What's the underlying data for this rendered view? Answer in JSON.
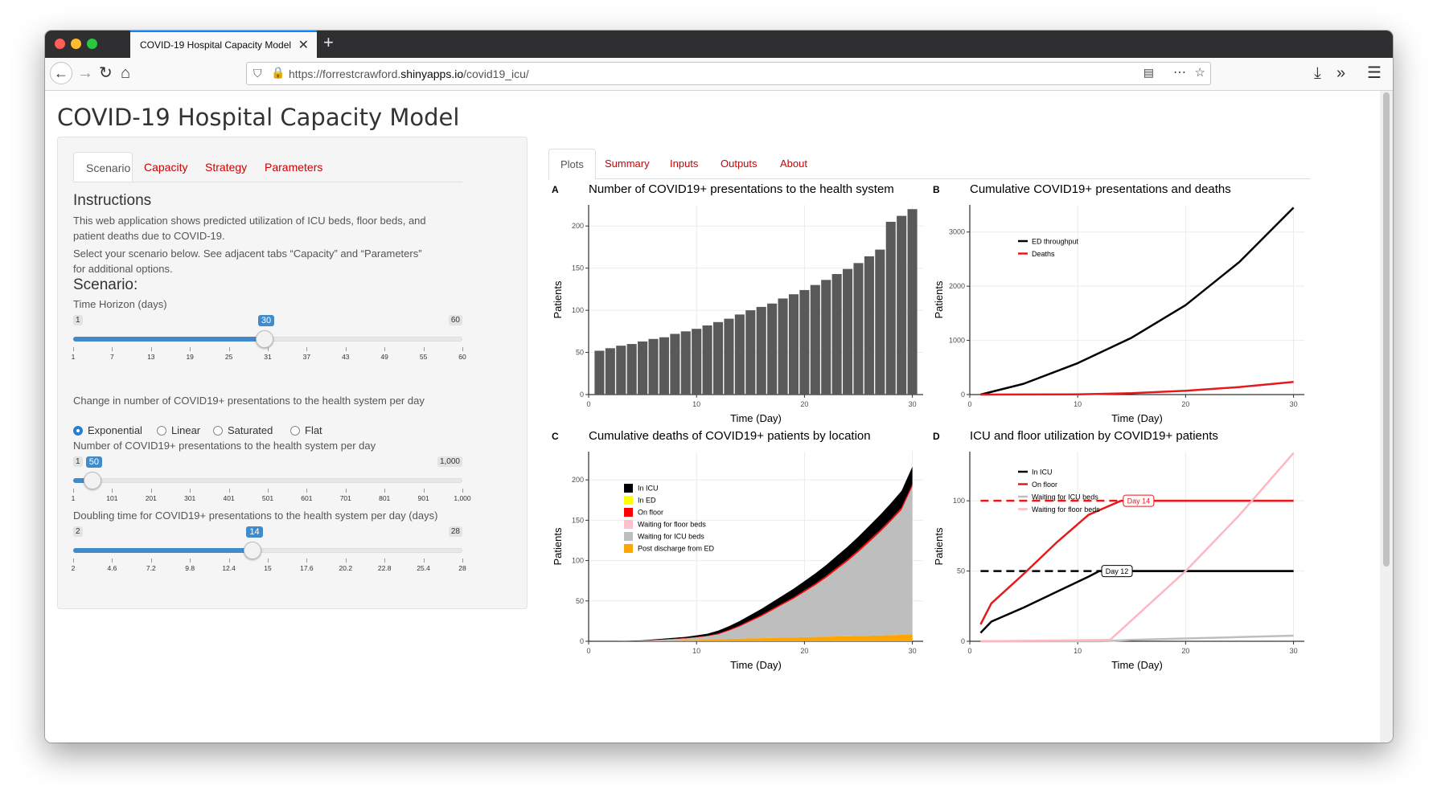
{
  "browser": {
    "tab_title": "COVID-19 Hospital Capacity Model",
    "url_host": "https://forrestcrawford.",
    "url_bold": "shinyapps.io",
    "url_path": "/covid19_icu/"
  },
  "page_title": "COVID-19 Hospital Capacity Model",
  "sidebar": {
    "tabs": [
      "Scenario",
      "Capacity",
      "Strategy",
      "Parameters"
    ],
    "active_tab": "Scenario",
    "instructions_heading": "Instructions",
    "instructions_p1": "This web application shows predicted utilization of ICU beds, floor beds, and patient deaths due to COVID-19.",
    "instructions_p2": "Select your scenario below. See adjacent tabs “Capacity” and “Parameters” for additional options.",
    "scenario_heading": "Scenario:",
    "time_horizon": {
      "label": "Time Horizon (days)",
      "min": 1,
      "max": 60,
      "value": 30,
      "min_label": "1",
      "max_label": "60",
      "value_label": "30",
      "ticks": [
        "1",
        "7",
        "13",
        "19",
        "25",
        "31",
        "37",
        "43",
        "49",
        "55",
        "60"
      ]
    },
    "growth_question": "Change in number of COVID19+ presentations to the health system per day",
    "growth_options": [
      "Exponential",
      "Linear",
      "Saturated",
      "Flat"
    ],
    "growth_selected": "Exponential",
    "presentations": {
      "label": "Number of COVID19+ presentations to the health system per day",
      "min": 1,
      "max": 1000,
      "value": 50,
      "min_label": "1",
      "max_label": "1,000",
      "value_label": "50",
      "ticks": [
        "1",
        "101",
        "201",
        "301",
        "401",
        "501",
        "601",
        "701",
        "801",
        "901",
        "1,000"
      ]
    },
    "doubling": {
      "label": "Doubling time for COVID19+ presentations to the health system per day (days)",
      "min": 2,
      "max": 28,
      "value": 14,
      "min_label": "2",
      "max_label": "28",
      "value_label": "14",
      "ticks": [
        "2",
        "4.6",
        "7.2",
        "9.8",
        "12.4",
        "15",
        "17.6",
        "20.2",
        "22.8",
        "25.4",
        "28"
      ]
    }
  },
  "main_tabs": [
    "Plots",
    "Summary",
    "Inputs",
    "Outputs",
    "About"
  ],
  "main_active_tab": "Plots",
  "chart_data": [
    {
      "type": "bar",
      "panel": "A",
      "title": "Number of COVID19+ presentations to the health system",
      "xlabel": "Time (Day)",
      "ylabel": "Patients",
      "xlim": [
        0,
        31
      ],
      "ylim": [
        0,
        225
      ],
      "xticks": [
        0,
        10,
        20,
        30
      ],
      "yticks": [
        0,
        50,
        100,
        150,
        200
      ],
      "color": "#595959",
      "categories": [
        1,
        2,
        3,
        4,
        5,
        6,
        7,
        8,
        9,
        10,
        11,
        12,
        13,
        14,
        15,
        16,
        17,
        18,
        19,
        20,
        21,
        22,
        23,
        24,
        25,
        26,
        27,
        28,
        29,
        30
      ],
      "values": [
        52,
        55,
        58,
        60,
        63,
        66,
        68,
        72,
        75,
        78,
        82,
        86,
        90,
        95,
        100,
        104,
        108,
        114,
        119,
        124,
        130,
        136,
        143,
        149,
        156,
        164,
        172,
        180,
        190,
        200
      ],
      "values_visible_last": [
        205,
        212,
        220
      ]
    },
    {
      "type": "line",
      "panel": "B",
      "title": "Cumulative COVID19+ presentations and deaths",
      "xlabel": "Time (Day)",
      "ylabel": "Patients",
      "xlim": [
        0,
        31
      ],
      "ylim": [
        0,
        3500
      ],
      "xticks": [
        0,
        10,
        20,
        30
      ],
      "yticks": [
        0,
        1000,
        2000,
        3000
      ],
      "legend_position": "top-left",
      "series": [
        {
          "name": "ED throughput",
          "color": "#000000",
          "x": [
            1,
            5,
            10,
            15,
            20,
            25,
            30
          ],
          "y": [
            0,
            200,
            580,
            1050,
            1650,
            2450,
            3450
          ]
        },
        {
          "name": "Deaths",
          "color": "#e41a1c",
          "x": [
            1,
            10,
            15,
            20,
            25,
            30
          ],
          "y": [
            0,
            5,
            25,
            70,
            140,
            235
          ]
        }
      ]
    },
    {
      "type": "area",
      "panel": "C",
      "title": "Cumulative deaths of COVID19+ patients by location",
      "xlabel": "Time (Day)",
      "ylabel": "Patients",
      "xlim": [
        0,
        31
      ],
      "ylim": [
        0,
        235
      ],
      "xticks": [
        0,
        10,
        20,
        30
      ],
      "yticks": [
        0,
        50,
        100,
        150,
        200
      ],
      "legend_position": "top-left",
      "x": [
        2.5,
        5,
        7,
        9,
        10,
        11,
        12,
        13,
        14,
        15,
        16,
        17,
        18,
        19,
        20,
        21,
        22,
        23,
        24,
        25,
        26,
        27,
        28,
        29,
        30
      ],
      "series": [
        {
          "name": "In ICU",
          "color": "#000000",
          "values": [
            0,
            0.5,
            1,
            1.5,
            2,
            2.5,
            3.5,
            4.5,
            5.5,
            6.5,
            7.5,
            8.5,
            9.5,
            10.5,
            11.5,
            12.5,
            13.5,
            14.5,
            15.5,
            16.5,
            17.5,
            18.5,
            19.5,
            20.5,
            21.5
          ]
        },
        {
          "name": "In ED",
          "color": "#ffff00",
          "values": [
            0,
            0,
            0,
            0,
            0,
            0,
            0,
            0,
            0,
            0,
            0,
            0,
            0,
            0,
            0,
            0,
            0,
            0,
            0,
            0,
            0,
            0,
            0,
            0,
            0
          ]
        },
        {
          "name": "On floor",
          "color": "#ff0000",
          "values": [
            0,
            0.3,
            0.4,
            0.5,
            0.6,
            0.7,
            1,
            1.2,
            1.4,
            1.5,
            1.6,
            1.7,
            1.8,
            1.9,
            2,
            2.1,
            2.2,
            2.3,
            2.4,
            2.5,
            2.6,
            2.7,
            2.8,
            2.9,
            3
          ]
        },
        {
          "name": "Waiting for floor beds",
          "color": "#ffc0cb",
          "values": [
            0,
            0,
            0,
            0,
            0,
            0,
            0,
            0,
            0,
            0,
            0,
            0,
            0,
            0,
            0,
            0,
            0,
            0,
            0,
            0,
            0,
            0,
            0,
            0,
            0
          ]
        },
        {
          "name": "Waiting for ICU beds",
          "color": "#bebebe",
          "values": [
            0,
            0,
            1,
            2,
            3,
            4,
            6,
            10,
            15,
            21,
            27,
            34,
            41,
            48,
            56,
            64,
            73,
            83,
            93,
            104,
            116,
            128,
            141,
            155,
            183
          ]
        },
        {
          "name": "Post discharge from ED",
          "color": "#ffa500",
          "values": [
            0,
            0.5,
            1,
            1.5,
            1.8,
            2.2,
            2.6,
            3,
            3.3,
            3.6,
            3.9,
            4.2,
            4.5,
            4.8,
            5.1,
            5.4,
            5.7,
            6,
            6.3,
            6.6,
            6.9,
            7.2,
            7.6,
            8,
            9
          ]
        }
      ]
    },
    {
      "type": "line",
      "panel": "D",
      "title": "ICU and floor utilization by COVID19+ patients",
      "xlabel": "Time (Day)",
      "ylabel": "Patients",
      "xlim": [
        0,
        31
      ],
      "ylim": [
        0,
        135
      ],
      "xticks": [
        0,
        10,
        20,
        30
      ],
      "yticks": [
        0,
        50,
        100
      ],
      "legend_position": "top-left",
      "series": [
        {
          "name": "In ICU",
          "color": "#000000",
          "x": [
            1,
            2,
            5,
            8,
            11,
            12,
            15,
            20,
            25,
            30
          ],
          "y": [
            6,
            14,
            24,
            35,
            46,
            50,
            50,
            50,
            50,
            50
          ]
        },
        {
          "name": "On floor",
          "color": "#e41a1c",
          "x": [
            1,
            2,
            5,
            8,
            11,
            14,
            15,
            20,
            25,
            30
          ],
          "y": [
            12,
            27,
            48,
            70,
            90,
            100,
            100,
            100,
            100,
            100
          ]
        },
        {
          "name": "Waiting for ICU beds",
          "color": "#bebebe",
          "x": [
            1,
            12,
            15,
            20,
            25,
            30
          ],
          "y": [
            0,
            0,
            1,
            2,
            3,
            4
          ]
        },
        {
          "name": "Waiting for floor beds",
          "color": "#ffb6c1",
          "x": [
            1,
            13,
            15,
            20,
            25,
            30
          ],
          "y": [
            0,
            1,
            15,
            50,
            90,
            134
          ]
        }
      ],
      "capacity_lines": [
        {
          "color": "#000000",
          "value": 50,
          "label": "Day 12",
          "day": 12
        },
        {
          "color": "#e41a1c",
          "value": 100,
          "label": "Day 14",
          "day": 14
        }
      ]
    }
  ]
}
